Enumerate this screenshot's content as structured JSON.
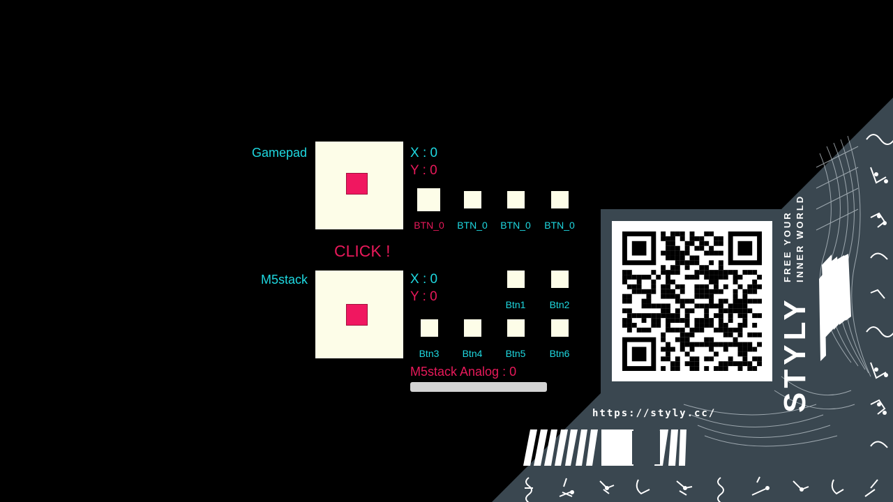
{
  "gamepad": {
    "label": "Gamepad",
    "x_text": "X : 0",
    "y_text": "Y : 0",
    "buttons": [
      "BTN_0",
      "BTN_0",
      "BTN_0",
      "BTN_0"
    ]
  },
  "click_text": "CLICK !",
  "m5stack": {
    "label": "M5stack",
    "x_text": "X : 0",
    "y_text": "Y : 0",
    "buttons": [
      "Btn1",
      "Btn2",
      "Btn3",
      "Btn4",
      "Btn5",
      "Btn6"
    ],
    "analog_text": "M5stack Analog : 0",
    "analog_value": 0
  },
  "styly": {
    "tagline_1": "FREE YOUR",
    "tagline_2": "INNER WORLD",
    "brand": "STYLY",
    "url": "https://styly.cc/"
  },
  "colors": {
    "accent_cyan": "#1ed8e0",
    "accent_pink": "#e8195a",
    "panel_bg": "#3a4750"
  }
}
